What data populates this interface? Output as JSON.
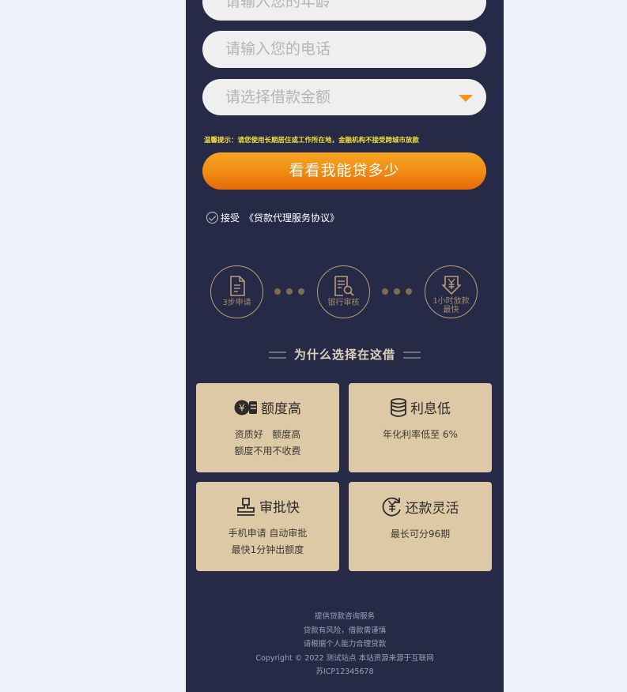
{
  "form": {
    "age_placeholder": "请输入您的年龄",
    "phone_placeholder": "请输入您的电话",
    "amount_placeholder": "请选择借款金额",
    "notice": "温馨提示：请您使用长期居住或工作所在地，金融机构不接受跨城市放款",
    "submit_label": "看看我能贷多少",
    "agree_label": "接受",
    "agreement_link": "《贷款代理服务协议》"
  },
  "steps": [
    {
      "label": "3步申请",
      "icon": "document-icon"
    },
    {
      "label": "银行审核",
      "icon": "review-icon"
    },
    {
      "label_line1": "1小时放款",
      "label_line2": "最快",
      "icon": "yen-down-icon"
    }
  ],
  "why": {
    "title": "为什么选择在这借"
  },
  "features": [
    {
      "title": "额度高",
      "line1": "资质好   额度高",
      "line2": "额度不用不收费",
      "icon": "yen-card-icon"
    },
    {
      "title": "利息低",
      "line1": "年化利率低至 6%",
      "line2": "",
      "icon": "coins-icon"
    },
    {
      "title": "审批快",
      "line1": "手机申请 自动审批",
      "line2": "最快1分钟出额度",
      "icon": "stamp-icon"
    },
    {
      "title": "还款灵活",
      "line1": "最长可分96期",
      "line2": "",
      "icon": "yen-cycle-icon"
    }
  ],
  "footer": {
    "line1": "提供贷款咨询服务",
    "line2": "贷款有风险，借款需谨慎",
    "line3": "请根据个人能力合理贷款",
    "line4": "Copyright © 2022 测试站点 本站资源来源于互联网",
    "line5": "苏ICP12345678"
  },
  "colors": {
    "page_bg": "#262a47",
    "accent": "#f08a13",
    "card_bg": "#ddc9a6"
  }
}
